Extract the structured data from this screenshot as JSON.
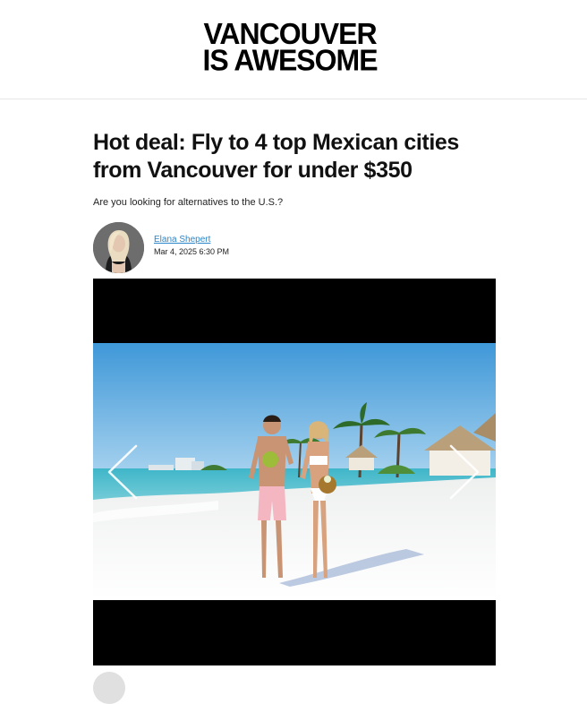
{
  "site": {
    "logo_line1": "VANCOUVER",
    "logo_line2": "IS AWESOME"
  },
  "article": {
    "title": "Hot deal: Fly to 4 top Mexican cities from Vancouver for under $350",
    "subtitle": "Are you looking for alternatives to the U.S.?",
    "author": "Elana Shepert",
    "date": "Mar 4, 2025 6:30 PM"
  },
  "gallery": {
    "prev_icon": "chevron-left-icon",
    "next_icon": "chevron-right-icon"
  },
  "colors": {
    "link": "#2a86c8",
    "gallery_bg": "#000000"
  }
}
